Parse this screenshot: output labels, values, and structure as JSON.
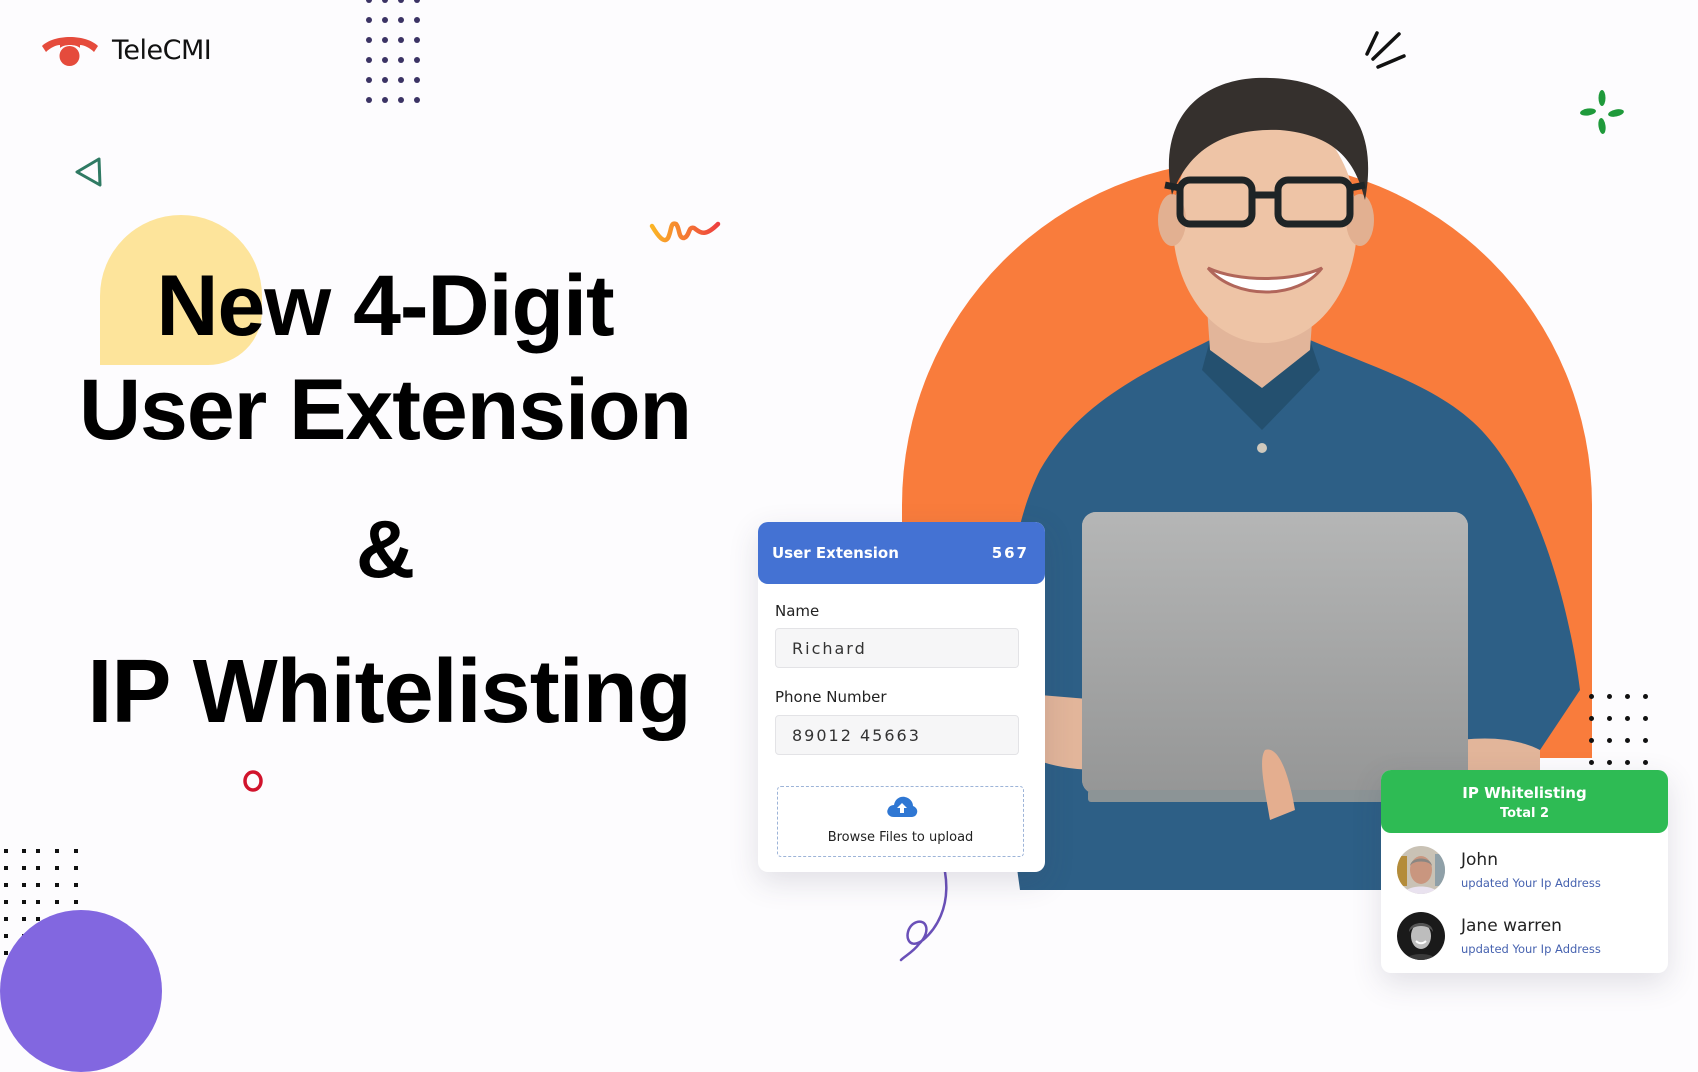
{
  "brand": {
    "name": "TeleCMI",
    "logo_color": "#e54b3c"
  },
  "headline": {
    "line1": "New 4-Digit",
    "line2": "User Extension",
    "line3": "&",
    "line4": "IP Whitelisting"
  },
  "colors": {
    "orange": "#f97c3c",
    "purple": "#8267e0",
    "blue": "#4472d3",
    "green": "#2ebb54",
    "highlight": "#fde49b"
  },
  "user_extension_card": {
    "title": "User Extension",
    "count": "567",
    "name_label": "Name",
    "name_value": "Richard",
    "phone_label": "Phone Number",
    "phone_value": "89012 45663",
    "upload_label": "Browse Files to upload",
    "upload_icon": "cloud-upload-icon"
  },
  "ip_card": {
    "title": "IP Whitelisting",
    "subtitle": "Total 2",
    "entries": [
      {
        "name": "John",
        "description": "updated Your Ip Address"
      },
      {
        "name": "Jane warren",
        "description": "updated Your Ip Address"
      }
    ]
  }
}
